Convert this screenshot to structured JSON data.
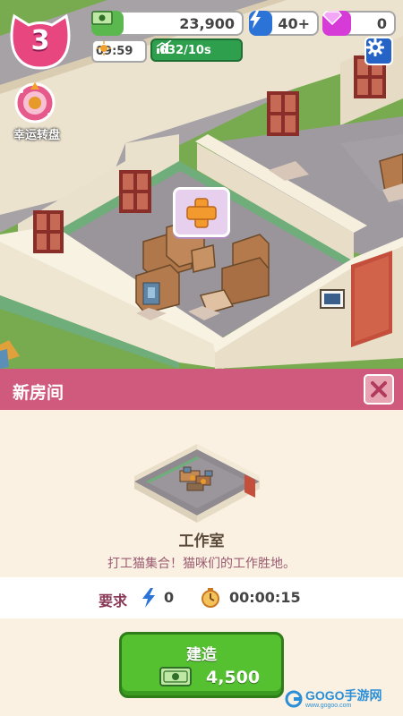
{
  "hud": {
    "level": "3",
    "cash": "23,900",
    "energy": "40+",
    "gems": "0",
    "time": "09:59",
    "income_rate": "632/10s",
    "lucky_wheel_label": "幸运转盘"
  },
  "panel": {
    "title": "新房间",
    "room_name": "工作室",
    "room_description": "打工猫集合！猫咪们的工作胜地。",
    "requirement_label": "要求",
    "energy_required": "0",
    "build_time": "00:00:15",
    "build_label": "建造",
    "build_cost": "4,500"
  },
  "watermark": {
    "brand": "GOGO手游网",
    "url": "www.gogoo.com"
  },
  "colors": {
    "header_pink": "#cf5a7e",
    "build_green": "#55c030",
    "settings_blue": "#2563c7",
    "cash_green": "#4caf50",
    "gem_purple": "#d62bd6"
  },
  "icons": [
    "cat-level-badge-icon",
    "cash-icon",
    "lightning-icon",
    "gem-icon",
    "sun-icon",
    "income-chart-icon",
    "gear-icon",
    "lucky-wheel-icon",
    "plus-icon",
    "close-icon",
    "clock-icon"
  ]
}
